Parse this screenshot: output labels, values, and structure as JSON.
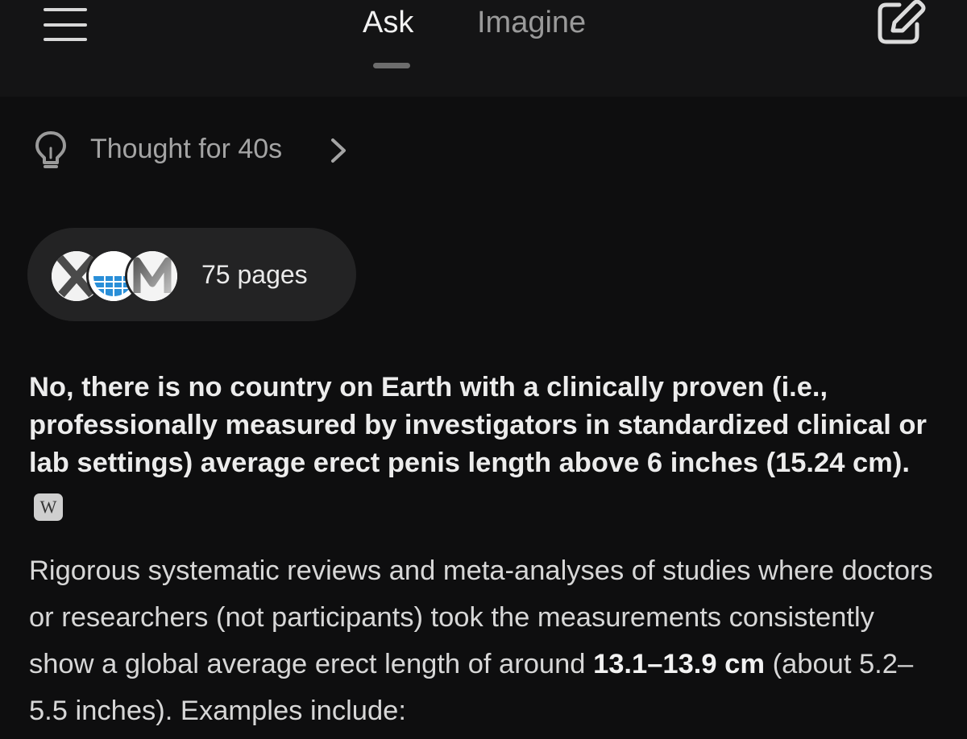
{
  "header": {
    "tabs": [
      {
        "label": "Ask",
        "active": true
      },
      {
        "label": "Imagine",
        "active": false
      }
    ],
    "menu_icon": "hamburger-menu-icon",
    "compose_icon": "edit-icon"
  },
  "thought": {
    "label": "Thought for 40s",
    "icon": "lightbulb-icon"
  },
  "sources": {
    "label": "75 pages",
    "favicons": [
      "x-logo-favicon",
      "globe-favicon",
      "m-logo-favicon"
    ]
  },
  "answer": {
    "lead": "No, there is no country on Earth with a clinically proven (i.e., professionally measured by investigators in standardized clinical or lab settings) average erect penis length above 6 inches (15.24 cm).",
    "citation_badge": "W",
    "body_before": "Rigorous systematic reviews and meta-analyses of studies where doctors or researchers (not participants) took the measurements consistently show a global average erect length of around ",
    "body_bold": "13.1–13.9 cm",
    "body_after": " (about 5.2–5.5 inches). Examples include:"
  },
  "colors": {
    "background": "#0e0e0f",
    "pill": "#232324",
    "text_primary": "#ececec",
    "text_muted": "#a4a4a4"
  }
}
